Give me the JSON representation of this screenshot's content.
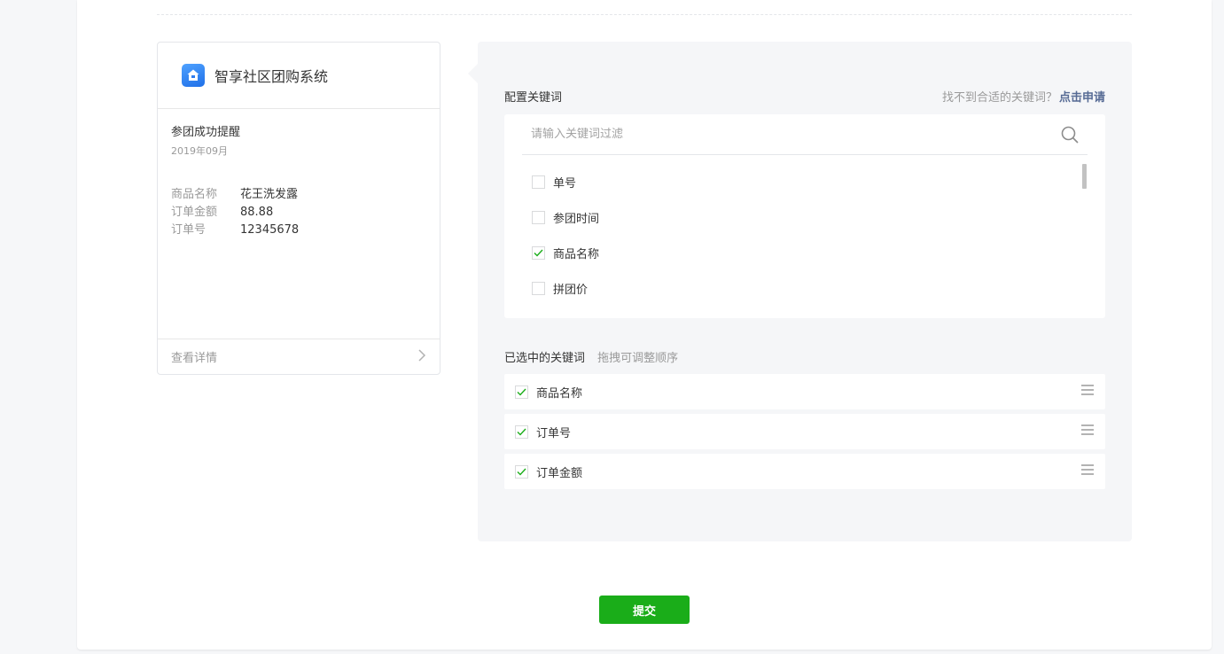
{
  "preview": {
    "app_name": "智享社区团购系统",
    "message_title": "参团成功提醒",
    "message_date": "2019年09月",
    "fields": [
      {
        "key": "商品名称",
        "value": "花王洗发露"
      },
      {
        "key": "订单金额",
        "value": "88.88"
      },
      {
        "key": "订单号",
        "value": "12345678"
      }
    ],
    "detail_link": "查看详情"
  },
  "config": {
    "title": "配置关键词",
    "hint": "找不到合适的关键词？",
    "apply_link": "点击申请",
    "search_placeholder": "请输入关键词过滤",
    "keywords": [
      {
        "label": "单号",
        "checked": false
      },
      {
        "label": "参团时间",
        "checked": false
      },
      {
        "label": "商品名称",
        "checked": true
      },
      {
        "label": "拼团价",
        "checked": false
      }
    ]
  },
  "selected": {
    "title": "已选中的关键词",
    "hint": "拖拽可调整顺序",
    "items": [
      {
        "label": "商品名称",
        "checked": true
      },
      {
        "label": "订单号",
        "checked": true
      },
      {
        "label": "订单金额",
        "checked": true
      }
    ]
  },
  "submit_label": "提交",
  "colors": {
    "accent": "#1aad19",
    "link": "#576b95",
    "check": "#1aad19"
  }
}
